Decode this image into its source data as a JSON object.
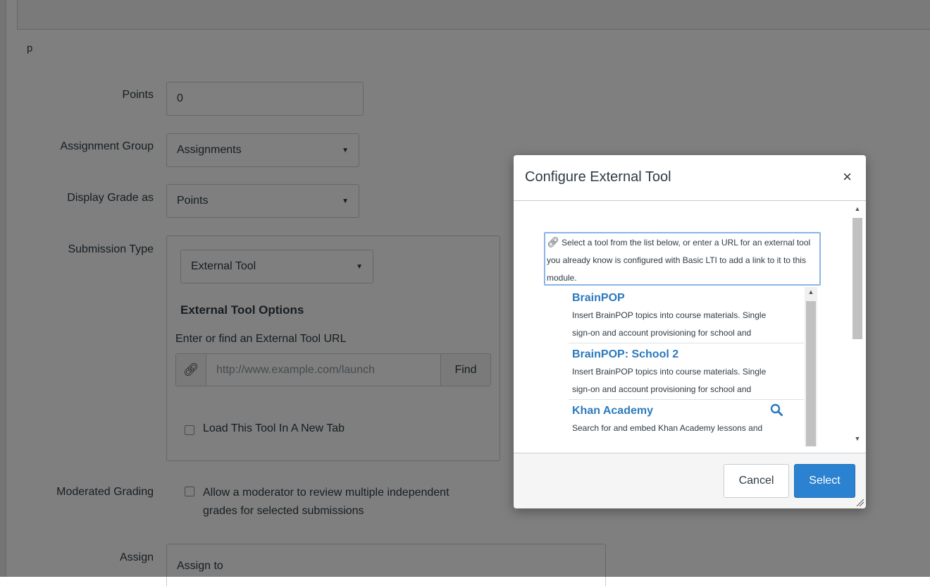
{
  "background": {
    "stray_text": "p",
    "points": {
      "label": "Points",
      "value": "0"
    },
    "assignment_group": {
      "label": "Assignment Group",
      "value": "Assignments"
    },
    "display_grade": {
      "label": "Display Grade as",
      "value": "Points"
    },
    "submission_type": {
      "label": "Submission Type",
      "value": "External Tool",
      "options_title": "External Tool Options",
      "url_label": "Enter or find an External Tool URL",
      "url_placeholder": "http://www.example.com/launch",
      "find_label": "Find",
      "new_tab_label": "Load This Tool In A New Tab"
    },
    "moderated_grading": {
      "label": "Moderated Grading",
      "line1": "Allow a moderator to review multiple independent",
      "line2": "grades for selected submissions"
    },
    "assign": {
      "label": "Assign",
      "field_label": "Assign to"
    }
  },
  "modal": {
    "title": "Configure External Tool",
    "close_glyph": "×",
    "description": "Select a tool from the list below, or enter a URL for an external tool you already know is configured with Basic LTI to add a link to it to this module.",
    "tools": [
      {
        "name": "BrainPOP",
        "desc1": "Insert BrainPOP topics into course materials. Single",
        "desc2": "sign-on and account provisioning for school and"
      },
      {
        "name": "BrainPOP: School 2",
        "desc1": "Insert BrainPOP topics into course materials. Single",
        "desc2": "sign-on and account provisioning for school and"
      },
      {
        "name": "Khan Academy",
        "desc1": "Search for and embed Khan Academy lessons and",
        "desc2": ""
      }
    ],
    "cancel_label": "Cancel",
    "select_label": "Select"
  },
  "colors": {
    "primary": "#2b82d0",
    "link": "#2b7abc",
    "overlay": "rgba(0,0,0,0.5)"
  },
  "icons": [
    "link-icon",
    "caret-down-icon",
    "close-icon",
    "search-icon",
    "resize-grip-icon"
  ]
}
